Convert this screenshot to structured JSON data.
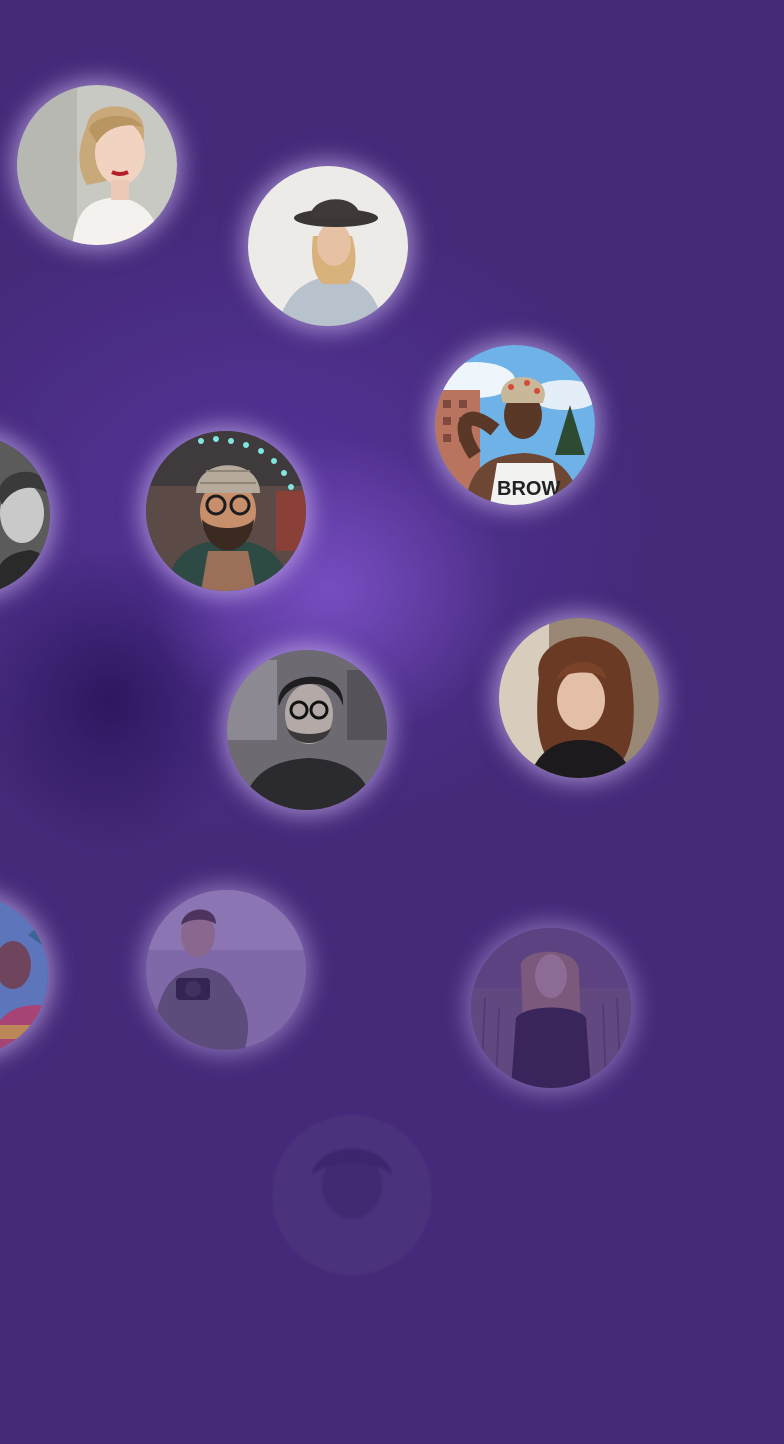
{
  "theme": {
    "background": "#452a7a",
    "accent_glow": "#dcc8ff"
  },
  "avatars": [
    {
      "name": "woman-blonde-avatar"
    },
    {
      "name": "woman-hat-avatar"
    },
    {
      "name": "man-cap-avatar"
    },
    {
      "name": "man-bw-avatar"
    },
    {
      "name": "bearded-man-beanie-avatar"
    },
    {
      "name": "woman-curly-hair-avatar"
    },
    {
      "name": "man-glasses-avatar"
    },
    {
      "name": "person-colorful-avatar"
    },
    {
      "name": "man-camera-avatar"
    },
    {
      "name": "woman-field-avatar"
    },
    {
      "name": "faded-avatar"
    }
  ]
}
